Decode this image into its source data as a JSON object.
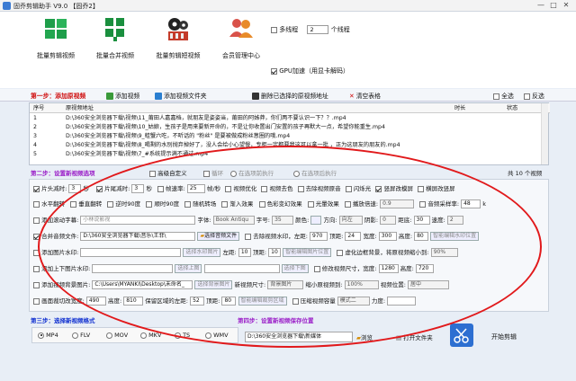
{
  "window": {
    "title": "固乔剪辑助手 V9.0 【固乔2】",
    "minimize": "—",
    "maximize": "□",
    "close": "✕"
  },
  "toolbar": {
    "buttons": [
      {
        "label": "批量剪辑视频"
      },
      {
        "label": "批量合并视频"
      },
      {
        "label": "批量剪辑短视频"
      },
      {
        "label": "会员管理中心"
      }
    ],
    "multithread_label": "多线程",
    "thread_count": "2",
    "thread_unit": "个线程",
    "gpu_label": "GPU加速（用显卡解码）"
  },
  "step1": {
    "label": "第一步：添加原视频",
    "add_video": "添加视频",
    "add_folder": "添加视频文件夹",
    "delete_added": "删除已选择的原视频地址",
    "clear_table": "清空表格",
    "select_all": "全选",
    "invert": "反选"
  },
  "table": {
    "headers": [
      "序号",
      "原视频地址",
      "时长",
      "状态"
    ],
    "rows": [
      {
        "no": "1",
        "path": "D:\\360安全浏览器下载\\视频\\11_莆田人嘉嘉档，就朋友是姿姿当，莆田的阿姊莽，你们两不要认识一下？？.mp4"
      },
      {
        "no": "2",
        "path": "D:\\360安全浏览器下载\\视频\\10_姑娘，生孩子是用来要新开命的，不是让你收置出门安置的孩子再默大一点，希望你能重生.mp4"
      },
      {
        "no": "3",
        "path": "D:\\360安全浏览器下载\\视频\\9_蛙蟹六吃，不听话的 \"粉丝\" 是要被做成粉丝葱圈的哦.mp4"
      },
      {
        "no": "4",
        "path": "D:\\360安全浏览器下载\\视频\\8_喝剩的水别抛弃掉好了，没人会给小心望慢，专柜一定都要我这可以拿一批 ，正为这朋友的朋友的.mp4"
      },
      {
        "no": "5",
        "path": "D:\\360安全浏览器下载\\视频\\7_#系统提示满不通过.mp4"
      }
    ]
  },
  "step2": {
    "label": "第二步：设置新视频选项",
    "advanced": "高级自定义",
    "loop": "循环",
    "in_order": "在选项前执行",
    "after_order": "在选项后执行",
    "count": "共 10 个视频"
  },
  "settings": {
    "row1": {
      "head_cut": "片头减时:",
      "head_value": "3",
      "sec": "秒",
      "tail_cut": "片尾减时:",
      "tail_value": "3",
      "fps": "帧速率:",
      "fps_value": "25",
      "fps_unit": "帧/秒",
      "optimize": "视频优化",
      "color": "视频去色",
      "remove_audio": "去除视频原音",
      "flash": "闪烁光",
      "scroll_blur": "竖屏改模屏",
      "horiz_to_vert": "横屏改竖屏"
    },
    "row2": {
      "hmirror": "水平翻转",
      "vmirror": "垂直翻转",
      "rot90": "逆时90度",
      "rot90b": "顺时90度",
      "random_rot": "随机转场",
      "fade": "渐入效果",
      "color_fx": "色彩变幻效果",
      "light": "光暈效果",
      "speed": "播放倍速:",
      "speed_value": "0.9",
      "audio_vol": "音频采样率:",
      "audio_value": "48",
      "audio_unit": "k"
    },
    "row3": {
      "scroll_sub": "添加滚动字幕:",
      "sub_text": "小林说影视",
      "font": "字体:",
      "font_value": "Book Antiqu",
      "size": "字号:",
      "size_value": "35",
      "color": "颜色:",
      "dir": "方向:",
      "dir_value": "向左",
      "shadow": "阴影:",
      "shadow_value": "0",
      "dist": "距底:",
      "dist_value": "30",
      "speed": "速度:",
      "speed_value": "2"
    },
    "row4": {
      "merge_audio": "合并音频文件:",
      "audio_path": "D:\\360安全浏览器下载\\音乐\\王菲\\",
      "pick_audio": "选择音频文件",
      "remove_wm": "去除视频水印，左距:",
      "left": "970",
      "top_label": "顶距:",
      "top": "24",
      "width_label": "宽度:",
      "width": "300",
      "height_label": "高度:",
      "height": "80",
      "smart_pos": "智能编辑水印位置"
    },
    "row5": {
      "top_img": "添加图片水印:",
      "pick_wm": "选择水印图片",
      "left": "左距:",
      "left_v": "10",
      "top": "顶距:",
      "top_v": "10",
      "smart": "智能编辑图片位置",
      "blur": "虚化边框背景，将原视频缩小到:",
      "blur_v": "90%"
    },
    "row6": {
      "top_pic": "添加上下图片水印:",
      "pick_top": "选择上图",
      "pick_bottom": "选择下图",
      "fix_size": "修改视频尺寸，宽度:",
      "w": "1280",
      "h_label": "高度:",
      "h": "720"
    },
    "row7": {
      "bg_img": "添加视频背景图片:",
      "bg_path": "C:\\Users\\MYANKI\\Desktop\\未命名_",
      "pick_bg": "选择背景图片",
      "new_size": "新视频尺寸:",
      "new_size_v": "背景图片",
      "shrink": "缩小原视频到:",
      "shrink_v": "100%",
      "pos": "视频位置:",
      "pos_v": "居中"
    },
    "row8": {
      "clip": "画面裁切改宽度:",
      "clip_w": "490",
      "clip_h_label": "高度:",
      "clip_h": "810",
      "keep": "保留区域的左距:",
      "keep_left": "52",
      "keep_top_label": "顶距:",
      "keep_top": "80",
      "smart": "智能编辑裁剪区域",
      "compress": "压缩视频容量",
      "mode": "模式二",
      "quality": "力度:"
    }
  },
  "step3": {
    "label": "第三步：选择新视频格式",
    "formats": [
      "MP4",
      "FLV",
      "MOV",
      "MKV",
      "TS",
      "WMV"
    ]
  },
  "step4": {
    "label": "第四步：设置新视频保存位置",
    "path": "D:\\360安全浏览器下载\\新媒体",
    "browse": "浏览",
    "open_folder": "打开文件夹",
    "start": "开始剪辑"
  },
  "colors": {
    "step_red": "#d01010",
    "step_purple": "#9b20c8",
    "step_blue": "#1030d0",
    "annotation": "#e1191b"
  }
}
